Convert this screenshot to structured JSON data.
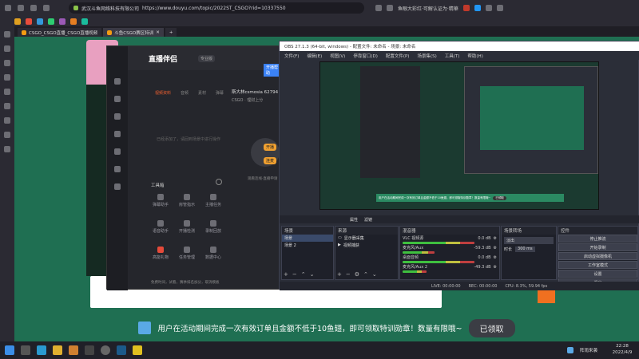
{
  "browser": {
    "url_site": "武汉斗鱼网络科技有限公司",
    "url": "https://www.douyu.com/topic/2022ST_CSGO?rid=10337550",
    "notification": "鱼眼大彩红·可解认证为·精華",
    "tabs": [
      {
        "label": "CSGO_CSGO直播_CSGO直播视频"
      },
      {
        "label": "斗鱼CSGO赛区特训"
      }
    ]
  },
  "helper": {
    "brand": "直播伴侣",
    "badge": "专业版",
    "button": "开播帮助",
    "room_title": "斯大林csmosia 62794",
    "room_sub": "CSGO · 理财上分",
    "tabs": [
      "视频资料",
      "音频",
      "素材",
      "弹幕"
    ],
    "empty_hint": "已经添加了，请回到场景中进行操作",
    "tools_title": "工具箱",
    "tools": [
      "弹幕助手",
      "房管指示",
      "主播任务",
      "语音助手",
      "开播检测",
      "录制回放",
      "高能礼物",
      "任务管理",
      "数据中心"
    ],
    "footer": "免费时间，试看，赛季排名加分，取消模板",
    "start1": "开播",
    "start2": "连麦",
    "right_hint": "观看连线·直播申请"
  },
  "obs": {
    "title": "OBS 27.1.3 (64-bit, windows) - 配置文件: 未命名 - 场景: 未命名",
    "menu": [
      "文件(F)",
      "编辑(E)",
      "视图(V)",
      "停靠窗口(D)",
      "配置文件(P)",
      "场景集(S)",
      "工具(T)",
      "帮助(H)"
    ],
    "preview_banner": "用户在活动期间完成一次有效订单且金额不低于10鱼翅，即可领取特训勋章！数量有限哦~",
    "preview_claim": "已领取",
    "source_toolbar": [
      "属性",
      "滤镜"
    ],
    "docks": {
      "scenes": "场景",
      "sources": "来源",
      "mixer": "混音器",
      "transitions": "场景转场",
      "controls": "控件"
    },
    "scenes": [
      "场景",
      "场景 2"
    ],
    "sources": [
      "显示器采集",
      "视频捕获"
    ],
    "mixer": [
      {
        "name": "VLC 视频源",
        "db": "0.0 dB"
      },
      {
        "name": "麦克风/Aux",
        "db": "-59.3 dB"
      },
      {
        "name": "桌面音频",
        "db": "0.0 dB"
      },
      {
        "name": "麦克风/Aux 2",
        "db": "-49.3 dB"
      }
    ],
    "transition": {
      "type": "淡出",
      "duration_label": "时长",
      "duration": "300 ms"
    },
    "controls": [
      "停止推流",
      "开始录制",
      "启动虚拟摄像机",
      "工作室模式",
      "设置",
      "退出"
    ],
    "status": {
      "live": "LIVE: 00:00:00",
      "rec": "REC: 00:00:00",
      "cpu": "CPU: 8.3%, 59.94 fps"
    }
  },
  "banner": {
    "text": "用户在活动期间完成一次有效订单且金额不低于10鱼翅，即可领取特训勋章！数量有限哦~",
    "claim": "已领取"
  },
  "taskbar": {
    "weather": "阵雨来袭",
    "time": "22:28",
    "date": "2022/4/9"
  },
  "colors": {
    "page_bg": "#1f6f52",
    "obs_bg": "#2b2e38",
    "accent": "#f0a030"
  }
}
